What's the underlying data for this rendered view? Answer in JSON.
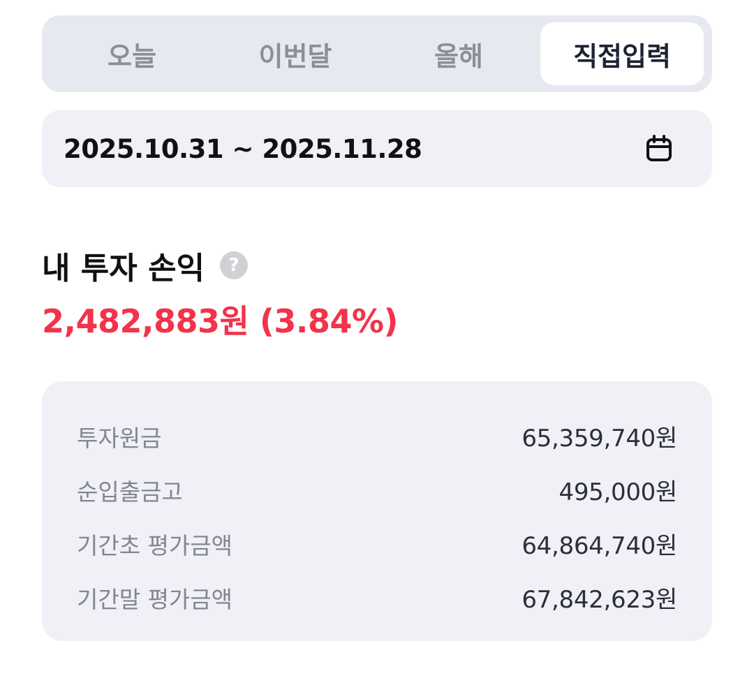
{
  "tabs": [
    {
      "label": "오늘",
      "active": false
    },
    {
      "label": "이번달",
      "active": false
    },
    {
      "label": "올해",
      "active": false
    },
    {
      "label": "직접입력",
      "active": true
    }
  ],
  "date_range": {
    "text": "2025.10.31 ~ 2025.11.28",
    "icon": "calendar-icon"
  },
  "profit": {
    "title": "내 투자 손익",
    "help_icon_glyph": "?",
    "value": "2,482,883원 (3.84%)",
    "color": "#f2334a"
  },
  "summary": {
    "rows": [
      {
        "label": "투자원금",
        "value": "65,359,740원"
      },
      {
        "label": "순입출금고",
        "value": "495,000원"
      },
      {
        "label": "기간초 평가금액",
        "value": "64,864,740원"
      },
      {
        "label": "기간말 평가금액",
        "value": "67,842,623원"
      }
    ]
  }
}
